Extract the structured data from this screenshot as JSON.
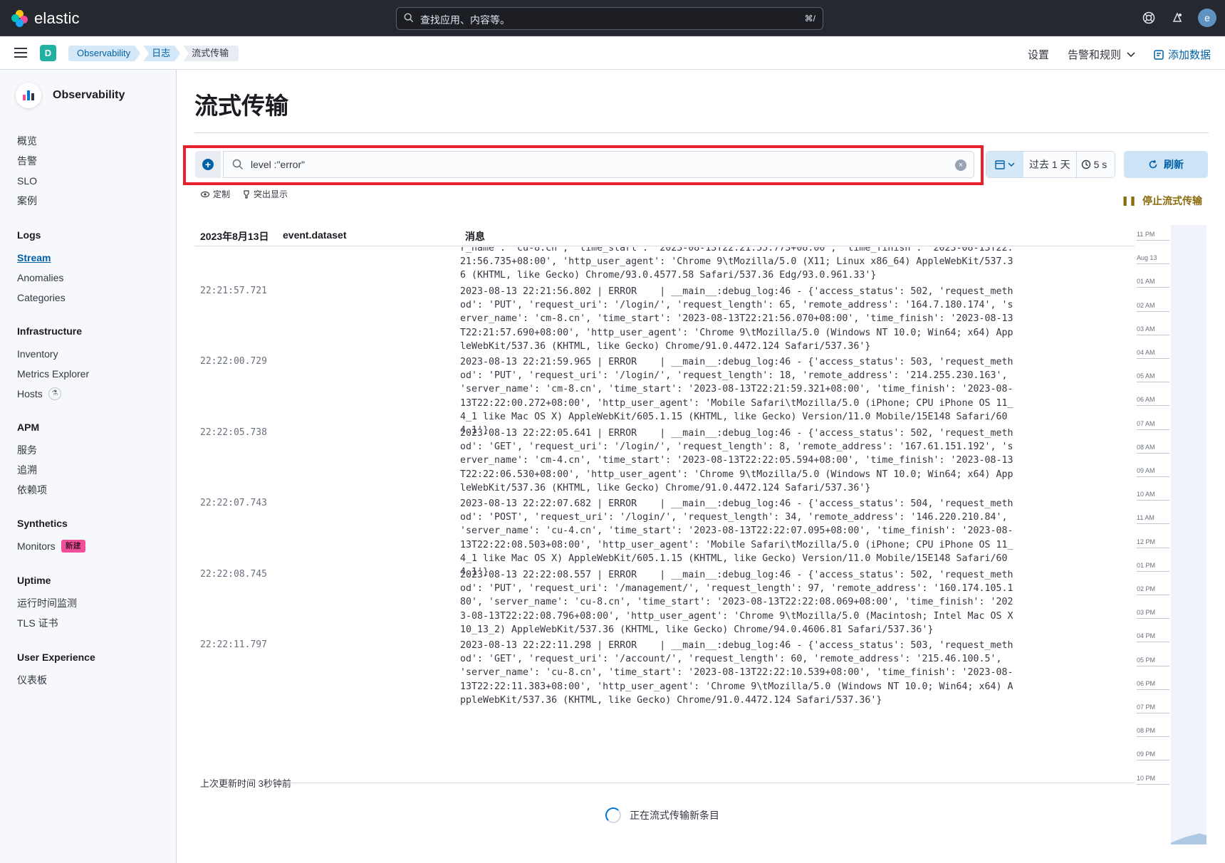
{
  "header": {
    "brand": "elastic",
    "search_placeholder": "查找应用、内容等。",
    "search_shortcut": "⌘/",
    "avatar_initial": "e"
  },
  "subheader": {
    "space_initial": "D",
    "breadcrumbs": [
      "Observability",
      "日志",
      "流式传输"
    ],
    "settings": "设置",
    "alerts_rules": "告警和规则",
    "add_data": "添加数据"
  },
  "sidebar": {
    "title": "Observability",
    "top_items": [
      "概览",
      "告警",
      "SLO",
      "案例"
    ],
    "groups": [
      {
        "title": "Logs",
        "items": [
          "Stream",
          "Anomalies",
          "Categories"
        ]
      },
      {
        "title": "Infrastructure",
        "items": [
          "Inventory",
          "Metrics Explorer",
          "Hosts"
        ]
      },
      {
        "title": "APM",
        "items": [
          "服务",
          "追溯",
          "依赖项"
        ]
      },
      {
        "title": "Synthetics",
        "items": [
          "Monitors"
        ],
        "badge": "新建"
      },
      {
        "title": "Uptime",
        "items": [
          "运行时间监测",
          "TLS 证书"
        ]
      },
      {
        "title": "User Experience",
        "items": [
          "仪表板"
        ]
      }
    ]
  },
  "main": {
    "title": "流式传输",
    "query": "level :\"error\"",
    "date_range": "过去 1 天",
    "refresh_interval": "5 s",
    "refresh_label": "刷新",
    "customize": "定制",
    "highlight": "突出显示",
    "stop_streaming": "停止流式传输",
    "columns": [
      "2023年8月13日",
      "event.dataset",
      "消息"
    ],
    "rows": [
      {
        "time": "",
        "message": "r_name': 'cu-8.cn', 'time_start': '2023-08-13T22:21:55.773+08:00', 'time_finish': '2023-08-13T22:21:56.735+08:00', 'http_user_agent': 'Chrome 9\\tMozilla/5.0 (X11; Linux x86_64) AppleWebKit/537.36 (KHTML, like Gecko) Chrome/93.0.4577.58 Safari/537.36 Edg/93.0.961.33'}"
      },
      {
        "time": "22:21:57.721",
        "message": "2023-08-13 22:21:56.802 | ERROR    | __main__:debug_log:46 - {'access_status': 502, 'request_method': 'PUT', 'request_uri': '/login/', 'request_length': 65, 'remote_address': '164.7.180.174', 'server_name': 'cm-8.cn', 'time_start': '2023-08-13T22:21:56.070+08:00', 'time_finish': '2023-08-13T22:21:57.690+08:00', 'http_user_agent': 'Chrome 9\\tMozilla/5.0 (Windows NT 10.0; Win64; x64) AppleWebKit/537.36 (KHTML, like Gecko) Chrome/91.0.4472.124 Safari/537.36'}"
      },
      {
        "time": "22:22:00.729",
        "message": "2023-08-13 22:21:59.965 | ERROR    | __main__:debug_log:46 - {'access_status': 503, 'request_method': 'PUT', 'request_uri': '/login/', 'request_length': 18, 'remote_address': '214.255.230.163', 'server_name': 'cm-8.cn', 'time_start': '2023-08-13T22:21:59.321+08:00', 'time_finish': '2023-08-13T22:22:00.272+08:00', 'http_user_agent': 'Mobile Safari\\tMozilla/5.0 (iPhone; CPU iPhone OS 11_4_1 like Mac OS X) AppleWebKit/605.1.15 (KHTML, like Gecko) Version/11.0 Mobile/15E148 Safari/604.1'}"
      },
      {
        "time": "22:22:05.738",
        "message": "2023-08-13 22:22:05.641 | ERROR    | __main__:debug_log:46 - {'access_status': 502, 'request_method': 'GET', 'request_uri': '/login/', 'request_length': 8, 'remote_address': '167.61.151.192', 'server_name': 'cm-4.cn', 'time_start': '2023-08-13T22:22:05.594+08:00', 'time_finish': '2023-08-13T22:22:06.530+08:00', 'http_user_agent': 'Chrome 9\\tMozilla/5.0 (Windows NT 10.0; Win64; x64) AppleWebKit/537.36 (KHTML, like Gecko) Chrome/91.0.4472.124 Safari/537.36'}"
      },
      {
        "time": "22:22:07.743",
        "message": "2023-08-13 22:22:07.682 | ERROR    | __main__:debug_log:46 - {'access_status': 504, 'request_method': 'POST', 'request_uri': '/login/', 'request_length': 34, 'remote_address': '146.220.210.84', 'server_name': 'cu-4.cn', 'time_start': '2023-08-13T22:22:07.095+08:00', 'time_finish': '2023-08-13T22:22:08.503+08:00', 'http_user_agent': 'Mobile Safari\\tMozilla/5.0 (iPhone; CPU iPhone OS 11_4_1 like Mac OS X) AppleWebKit/605.1.15 (KHTML, like Gecko) Version/11.0 Mobile/15E148 Safari/604.1'}"
      },
      {
        "time": "22:22:08.745",
        "message": "2023-08-13 22:22:08.557 | ERROR    | __main__:debug_log:46 - {'access_status': 502, 'request_method': 'PUT', 'request_uri': '/management/', 'request_length': 97, 'remote_address': '160.174.105.180', 'server_name': 'cu-8.cn', 'time_start': '2023-08-13T22:22:08.069+08:00', 'time_finish': '2023-08-13T22:22:08.796+08:00', 'http_user_agent': 'Chrome 9\\tMozilla/5.0 (Macintosh; Intel Mac OS X 10_13_2) AppleWebKit/537.36 (KHTML, like Gecko) Chrome/94.0.4606.81 Safari/537.36'}"
      },
      {
        "time": "22:22:11.797",
        "message": "2023-08-13 22:22:11.298 | ERROR    | __main__:debug_log:46 - {'access_status': 503, 'request_method': 'GET', 'request_uri': '/account/', 'request_length': 60, 'remote_address': '215.46.100.5', 'server_name': 'cu-8.cn', 'time_start': '2023-08-13T22:22:10.539+08:00', 'time_finish': '2023-08-13T22:22:11.383+08:00', 'http_user_agent': 'Chrome 9\\tMozilla/5.0 (Windows NT 10.0; Win64; x64) AppleWebKit/537.36 (KHTML, like Gecko) Chrome/91.0.4472.124 Safari/537.36'}"
      }
    ],
    "last_update": "上次更新时间 3秒钟前",
    "streaming_status": "正在流式传输新条目",
    "minimap_ticks": [
      "11 PM",
      "Aug 13",
      "01 AM",
      "02 AM",
      "03 AM",
      "04 AM",
      "05 AM",
      "06 AM",
      "07 AM",
      "08 AM",
      "09 AM",
      "10 AM",
      "11 AM",
      "12 PM",
      "01 PM",
      "02 PM",
      "03 PM",
      "04 PM",
      "05 PM",
      "06 PM",
      "07 PM",
      "08 PM",
      "09 PM",
      "10 PM"
    ]
  },
  "colors": {
    "accent": "#0061a6",
    "highlight_border": "#e7202d",
    "header_bg": "#25282f",
    "new_badge": "#f04e98"
  }
}
